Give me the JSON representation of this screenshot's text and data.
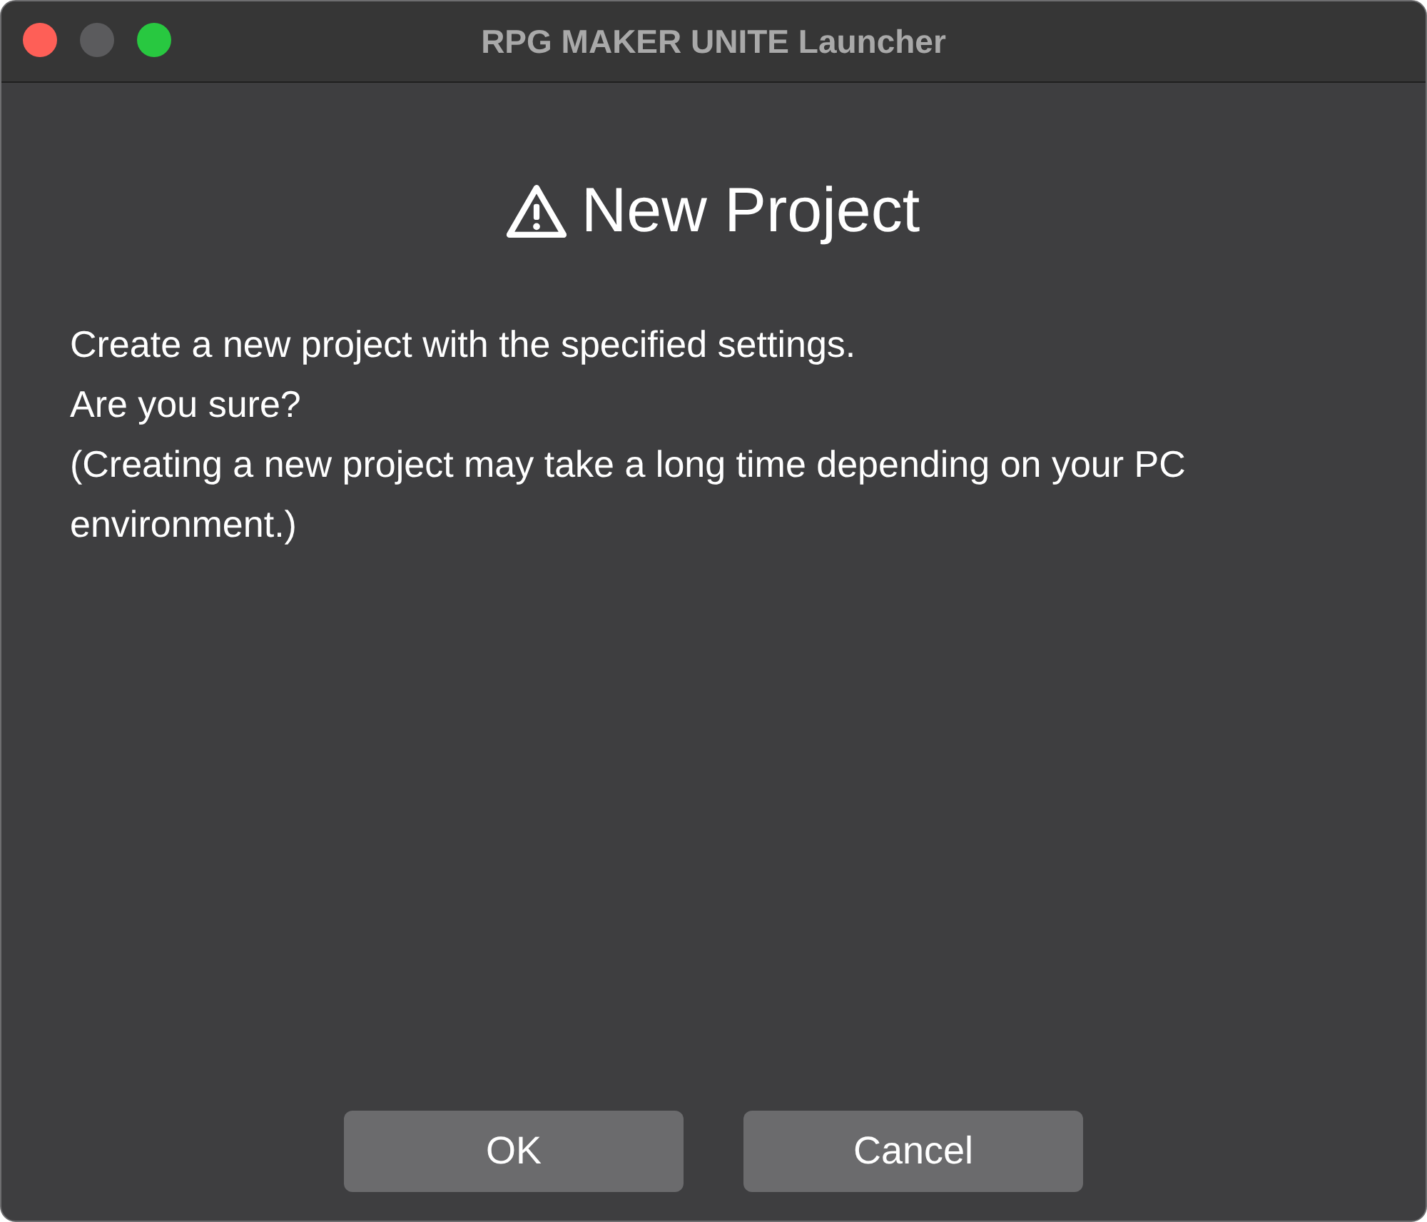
{
  "window": {
    "title": "RPG MAKER UNITE Launcher",
    "controls": [
      {
        "kind": "close",
        "disabled": false
      },
      {
        "kind": "minimize",
        "disabled": true
      },
      {
        "kind": "zoom",
        "disabled": false
      }
    ]
  },
  "dialog": {
    "heading": "New Project",
    "message_lines": [
      "Create a new project with the specified settings.",
      "Are you sure?",
      "(Creating a new project may take a long time depending on your PC environment.)"
    ]
  },
  "buttons": [
    "OK",
    "Cancel"
  ]
}
